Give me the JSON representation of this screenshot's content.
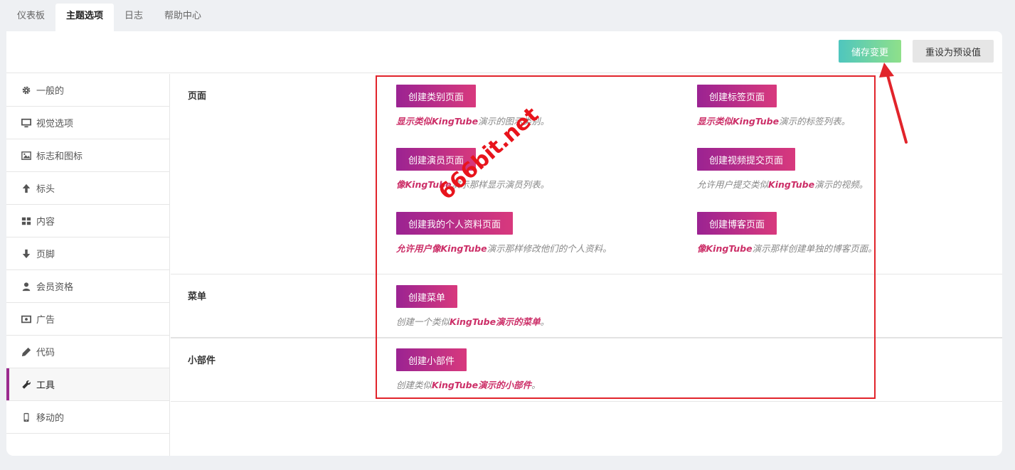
{
  "tabs": [
    "仪表板",
    "主题选项",
    "日志",
    "帮助中心"
  ],
  "toolbar": {
    "save_label": "储存变更",
    "reset_label": "重设为预设值"
  },
  "sidebar": {
    "items": [
      {
        "label": "一般的",
        "icon": "gear-icon"
      },
      {
        "label": "视觉选项",
        "icon": "monitor-icon"
      },
      {
        "label": "标志和图标",
        "icon": "image-icon"
      },
      {
        "label": "标头",
        "icon": "arrow-up-icon"
      },
      {
        "label": "内容",
        "icon": "grid-icon"
      },
      {
        "label": "页脚",
        "icon": "arrow-down-icon"
      },
      {
        "label": "会员资格",
        "icon": "user-icon"
      },
      {
        "label": "广告",
        "icon": "money-icon"
      },
      {
        "label": "代码",
        "icon": "pencil-icon"
      },
      {
        "label": "工具",
        "icon": "wrench-icon"
      },
      {
        "label": "移动的",
        "icon": "mobile-icon"
      }
    ],
    "active": "工具"
  },
  "sections": {
    "pages": {
      "label": "页面",
      "items": [
        {
          "button": "创建类别页面",
          "desc_bold": "显示类似KingTube",
          "desc_rest": "演示的图示类别。"
        },
        {
          "button": "创建标签页面",
          "desc_bold": "显示类似KingTube",
          "desc_rest": "演示的标签列表。"
        },
        {
          "button": "创建演员页面",
          "desc_bold": "像KingTube",
          "desc_rest": "演示那样显示演员列表。"
        },
        {
          "button": "创建视频提交页面",
          "desc_pre": "允许用户提交类似",
          "desc_bold": "KingTube",
          "desc_rest": "演示的视频。"
        },
        {
          "button": "创建我的个人资料页面",
          "desc_bold": "允许用户像KingTube",
          "desc_rest": "演示那样修改他们的个人资料。"
        },
        {
          "button": "创建博客页面",
          "desc_bold": "像KingTube",
          "desc_rest": "演示那样创建单独的博客页面。"
        }
      ]
    },
    "menu": {
      "label": "菜单",
      "button": "创建菜单",
      "desc_pre": "创建一个类似",
      "desc_bold": "KingTube演示的菜单",
      "desc_rest": "。"
    },
    "widgets": {
      "label": "小部件",
      "button": "创建小部件",
      "desc_pre": "创建类似",
      "desc_bold": "KingTube演示的小部件",
      "desc_rest": "。"
    }
  },
  "watermark": "666bit.net",
  "colors": {
    "accent": "#9b2392",
    "accent2": "#d8397d",
    "save_from": "#4fc6be",
    "save_to": "#8fe08a",
    "annotation": "#e1242b"
  }
}
